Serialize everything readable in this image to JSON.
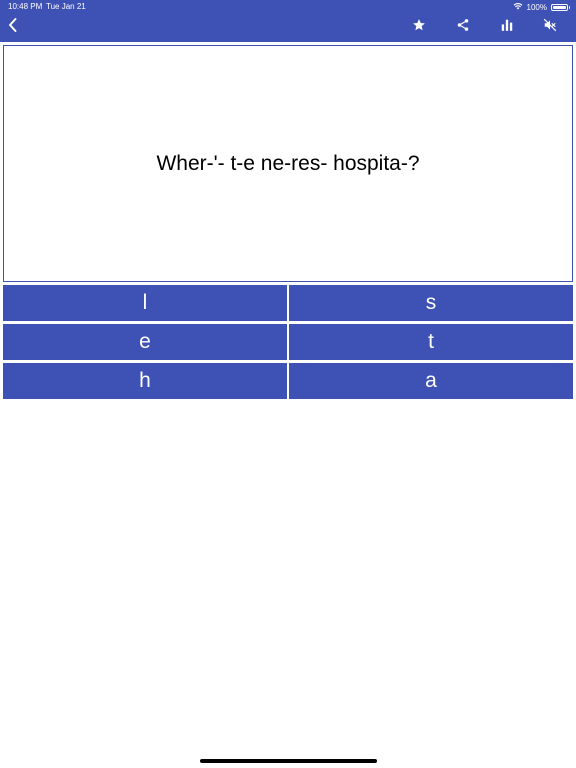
{
  "status_bar": {
    "time": "10:48 PM",
    "date": "Tue Jan 21",
    "battery": "100%",
    "wifi_icon": "wifi-icon",
    "battery_icon": "battery-icon"
  },
  "toolbar": {
    "back_icon": "chevron-left-icon",
    "favorite_icon": "star-icon",
    "share_icon": "share-icon",
    "stats_icon": "bar-chart-icon",
    "mute_icon": "speaker-mute-icon"
  },
  "question": {
    "text": "Wher-'- t-e ne-res- hospita-?"
  },
  "answers": [
    "l",
    "s",
    "e",
    "t",
    "h",
    "a"
  ],
  "colors": {
    "primary": "#3e51b5",
    "background": "#ffffff",
    "text": "#000000"
  }
}
